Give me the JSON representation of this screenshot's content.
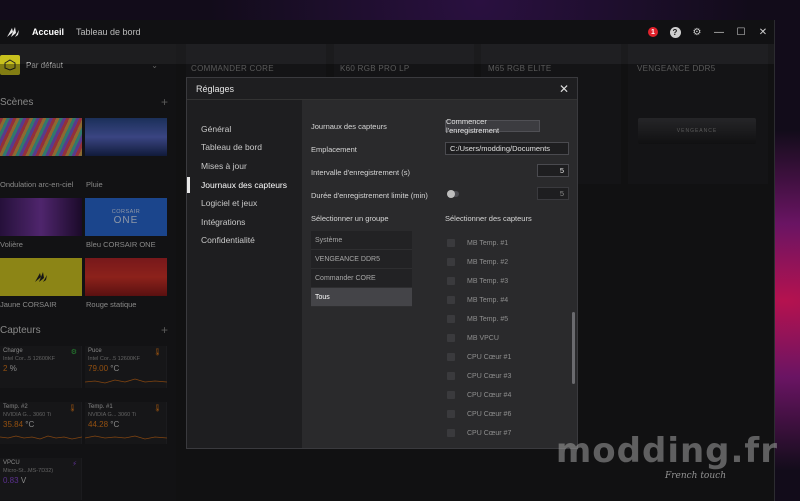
{
  "topbar": {
    "tabs": [
      {
        "label": "Accueil"
      },
      {
        "label": "Tableau de bord"
      }
    ],
    "notification_count": "1",
    "help_glyph": "?"
  },
  "sidebar": {
    "profile": {
      "label": "Par défaut"
    },
    "scenes_title": "Scènes",
    "scenes": [
      {
        "label": "Ondulation arc-en-ciel"
      },
      {
        "label": "Pluie"
      },
      {
        "label": "Volière"
      },
      {
        "label": "Bleu CORSAIR ONE"
      },
      {
        "label": "Jaune CORSAIR"
      },
      {
        "label": "Rouge statique"
      }
    ],
    "corsair_one_text": "CORSAIR",
    "corsair_one_sub": "ONE",
    "sensors_title": "Capteurs",
    "sensors": [
      {
        "title": "Charge",
        "sub": "Intel Cor...5 12600KF",
        "value": "2",
        "unit": "%",
        "color": "#e07a1a"
      },
      {
        "title": "Puce",
        "sub": "Intel Cor...5 12600KF",
        "value": "79.00",
        "unit": "°C",
        "color": "#e07a1a"
      },
      {
        "title": "Temp. #2",
        "sub": "NVIDIA G... 3060 Ti",
        "value": "35.84",
        "unit": "°C",
        "color": "#e07a1a"
      },
      {
        "title": "Temp. #1",
        "sub": "NVIDIA G... 3060 Ti",
        "value": "44.28",
        "unit": "°C",
        "color": "#e07a1a"
      },
      {
        "title": "VPCU",
        "sub": "Micro-St...MS-7D32)",
        "value": "0.83",
        "unit": "V",
        "color": "#8a4ad8"
      }
    ]
  },
  "devices": [
    {
      "name": "COMMANDER CORE"
    },
    {
      "name": "K60 RGB PRO LP"
    },
    {
      "name": "M65 RGB ELITE"
    },
    {
      "name": "VENGEANCE DDR5"
    }
  ],
  "ram_label": "VENGEANCE",
  "modal": {
    "title": "Réglages",
    "nav": [
      {
        "label": "Général"
      },
      {
        "label": "Tableau de bord"
      },
      {
        "label": "Mises à jour"
      },
      {
        "label": "Journaux des capteurs",
        "active": true
      },
      {
        "label": "Logiciel et jeux"
      },
      {
        "label": "Intégrations"
      },
      {
        "label": "Confidentialité"
      }
    ],
    "sensor_logs_label": "Journaux des capteurs",
    "start_button": "Commencer l'enregistrement",
    "location_label": "Emplacement",
    "location_value": "C:/Users/modding/Documents",
    "interval_label": "Intervalle d'enregistrement (s)",
    "interval_value": "5",
    "limit_label": "Durée d'enregistrement limite (min)",
    "limit_value": "5",
    "group_label": "Sélectionner un groupe",
    "sensors_label": "Sélectionner des capteurs",
    "groups": [
      {
        "label": "Système"
      },
      {
        "label": "VENGEANCE DDR5"
      },
      {
        "label": "Commander CORE"
      },
      {
        "label": "Tous",
        "selected": true
      }
    ],
    "sensor_items": [
      {
        "label": "MB Temp. #1"
      },
      {
        "label": "MB Temp. #2"
      },
      {
        "label": "MB Temp. #3"
      },
      {
        "label": "MB Temp. #4"
      },
      {
        "label": "MB Temp. #5"
      },
      {
        "label": "MB VPCU"
      },
      {
        "label": "CPU Cœur #1"
      },
      {
        "label": "CPU Cœur #3"
      },
      {
        "label": "CPU Cœur #4"
      },
      {
        "label": "CPU Cœur #6"
      },
      {
        "label": "CPU Cœur #7"
      }
    ]
  },
  "watermark": {
    "brand": "modding.fr",
    "tagline": "French touch"
  }
}
